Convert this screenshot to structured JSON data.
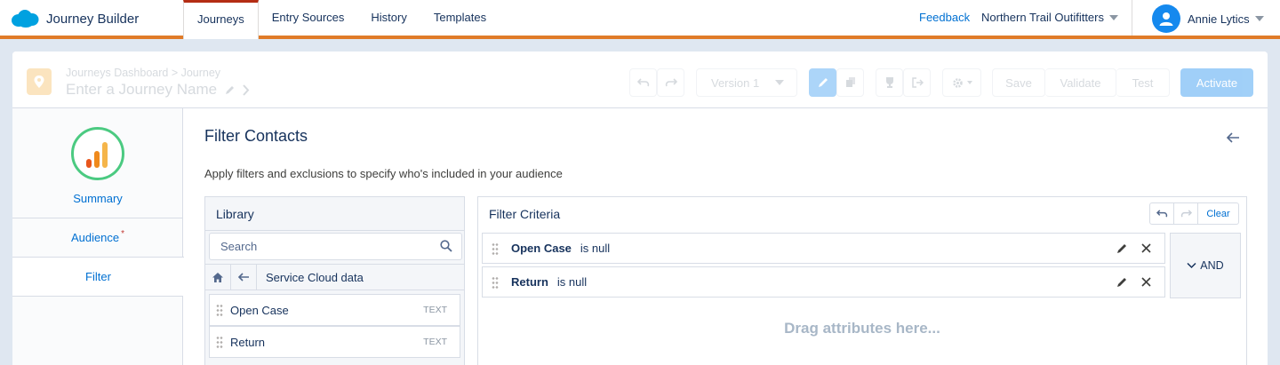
{
  "app": {
    "brand": "Journey Builder"
  },
  "nav": {
    "tabs": [
      "Journeys",
      "Entry Sources",
      "History",
      "Templates"
    ],
    "active_tab": "Journeys",
    "feedback": "Feedback",
    "org": "Northern Trail Outifitters",
    "user": "Annie Lytics"
  },
  "toolbar": {
    "breadcrumb": "Journeys Dashboard > Journey",
    "journey_name": "Enter a Journey Name",
    "version": "Version 1",
    "save": "Save",
    "validate": "Validate",
    "test": "Test",
    "activate": "Activate"
  },
  "sidebar": {
    "summary": "Summary",
    "items": [
      {
        "label": "Audience",
        "required": "*"
      },
      {
        "label": "Filter"
      }
    ]
  },
  "panel": {
    "title": "Filter Contacts",
    "description": "Apply filters and exclusions to specify who's included in your audience"
  },
  "library": {
    "title": "Library",
    "search_placeholder": "Search",
    "folder": "Service Cloud data",
    "attributes": [
      {
        "name": "Open Case",
        "type": "TEXT"
      },
      {
        "name": "Return",
        "type": "TEXT"
      }
    ]
  },
  "criteria": {
    "title": "Filter Criteria",
    "clear": "Clear",
    "rules": [
      {
        "field": "Open Case",
        "operator": "is null"
      },
      {
        "field": "Return",
        "operator": "is null"
      }
    ],
    "logic": "AND",
    "drop_hint": "Drag attributes here..."
  },
  "colors": {
    "accent": "#1589ee",
    "nav_underline": "#e07b28",
    "active_tab": "#b42d14",
    "link": "#0070d2"
  }
}
